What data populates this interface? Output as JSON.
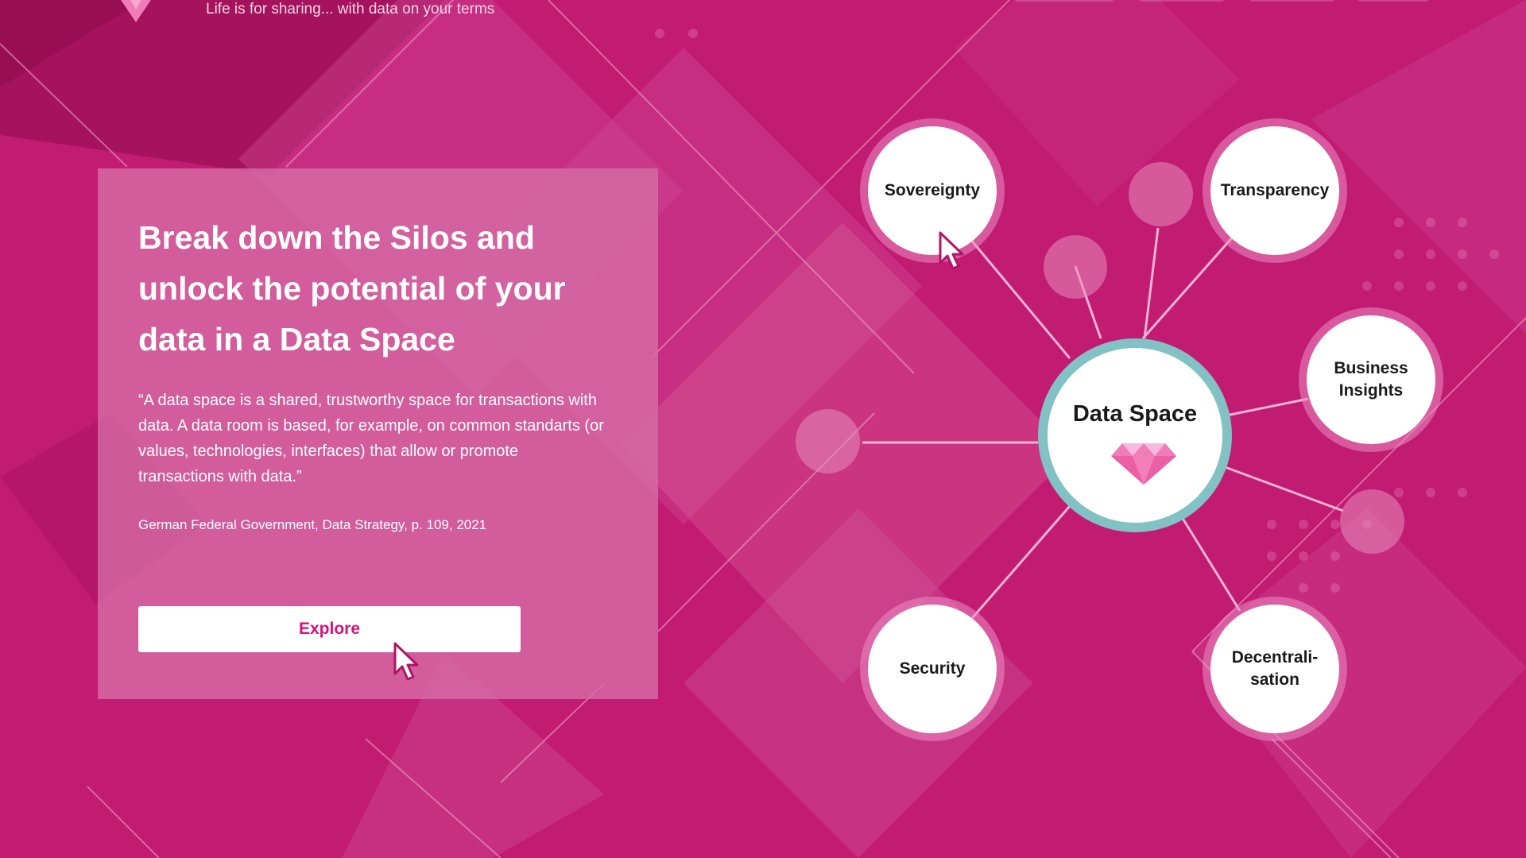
{
  "header": {
    "tagline": "Life is for sharing... with data on your terms",
    "logo_icon": "diamond-gem-icon"
  },
  "hero": {
    "title": "Break down the Silos and unlock the potential of your data in a Data Space",
    "quote": "“A data space is a shared, trustworthy space for transactions with data. A data room is based, for example, on common standarts (or values, technologies, interfaces) that allow or promote transactions with data.”",
    "source": "German Federal Government, Data Strategy, p. 109, 2021",
    "explore_label": "Explore"
  },
  "diagram": {
    "center_label": "Data Space",
    "nodes": [
      {
        "label": "Sovereignty"
      },
      {
        "label": "Transparency"
      },
      {
        "label": "Business\nInsights"
      },
      {
        "label": "Security"
      },
      {
        "label": "Decentrali-\nsation"
      }
    ]
  },
  "colors": {
    "background": "#c21b72",
    "card": "#d66ea8",
    "accent": "#d4117c",
    "center_ring": "#83c2c4",
    "node_ring": "#ec8cc3",
    "gem": "#f07cb8"
  }
}
